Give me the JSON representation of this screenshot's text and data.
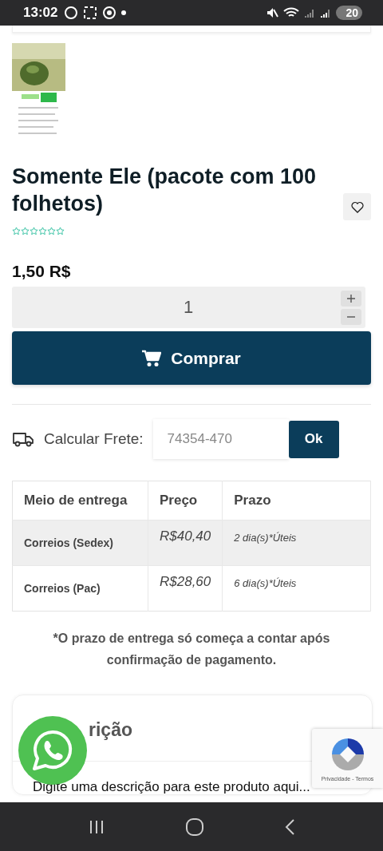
{
  "status_bar": {
    "time": "13:02",
    "battery": "20"
  },
  "product": {
    "title": "Somente Ele (pacote com 100 folhetos)",
    "favorite": false,
    "stars": 0,
    "price": "1,50 R$",
    "quantity": "1"
  },
  "buy_button": {
    "label": "Comprar"
  },
  "shipping": {
    "label": "Calcular Frete:",
    "placeholder": "74354-470",
    "button": "Ok"
  },
  "table": {
    "columns": [
      "Meio de entrega",
      "Preço",
      "Prazo"
    ],
    "rows": [
      {
        "cells": [
          "Correios (Sedex)",
          "R$40,40",
          "2 dia(s)*Úteis"
        ],
        "highlighted": true
      },
      {
        "cells": [
          "Correios (Pac)",
          "R$28,60",
          "6 dia(s)*Úteis"
        ],
        "highlighted": false
      }
    ]
  },
  "note": "*O prazo de entrega só começa a contar após confirmação de pagamento.",
  "description": {
    "title": "rição",
    "text": "Digite uma descrição para este produto aqui..."
  },
  "recaptcha": {
    "links": "Privacidade - Termos"
  }
}
